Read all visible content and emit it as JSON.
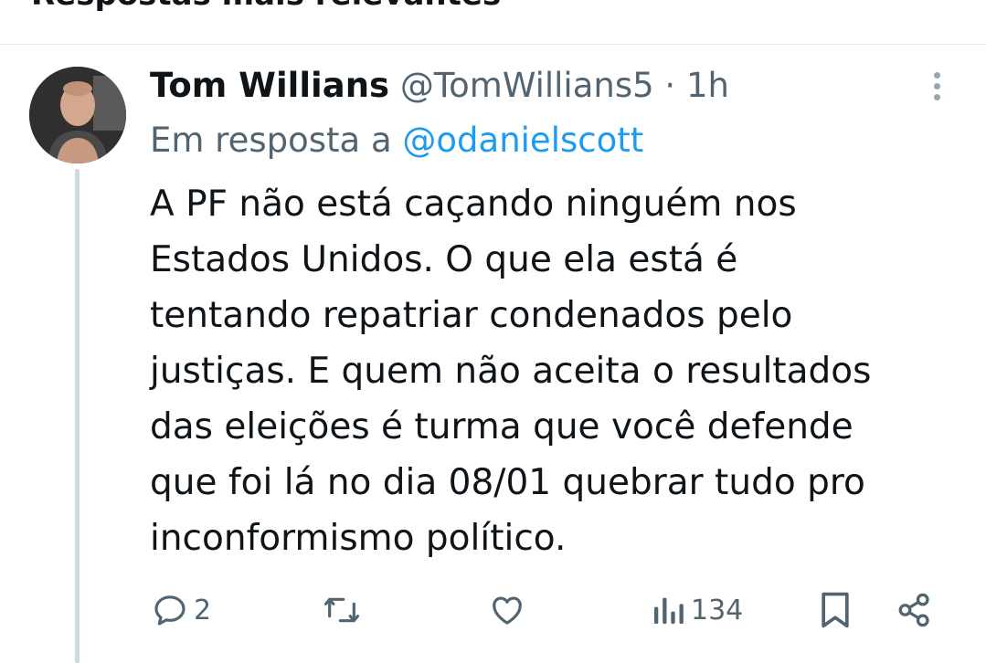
{
  "header": {
    "section_title": "Respostas mais relevantes"
  },
  "tweet": {
    "author_name": "Tom Willians",
    "handle": "@TomWillians5",
    "separator": "·",
    "time": "1h",
    "reply_prefix": "Em resposta a",
    "reply_mention": "@odanielscott",
    "text_lines": [
      "A PF não está caçando ninguém nos",
      "Estados Unidos. O que ela está é",
      "tentando repatriar condenados pelo",
      "justiças. E quem não aceita o resultados",
      "das eleições é turma que você defende",
      "que foi lá no dia 08/01 quebrar tudo pro",
      "inconformismo político."
    ]
  },
  "actions": {
    "reply_count": "2",
    "retweet_count": "",
    "like_count": "",
    "views_count": "134"
  },
  "icons": {
    "reply": "reply-icon",
    "retweet": "retweet-icon",
    "like": "heart-icon",
    "views": "views-icon",
    "bookmark": "bookmark-icon",
    "share": "share-icon",
    "more": "more-vertical-icon"
  },
  "colors": {
    "text": "#0f1419",
    "secondary": "#536471",
    "link": "#1d9bf0",
    "thread_line": "#cfd9de"
  }
}
